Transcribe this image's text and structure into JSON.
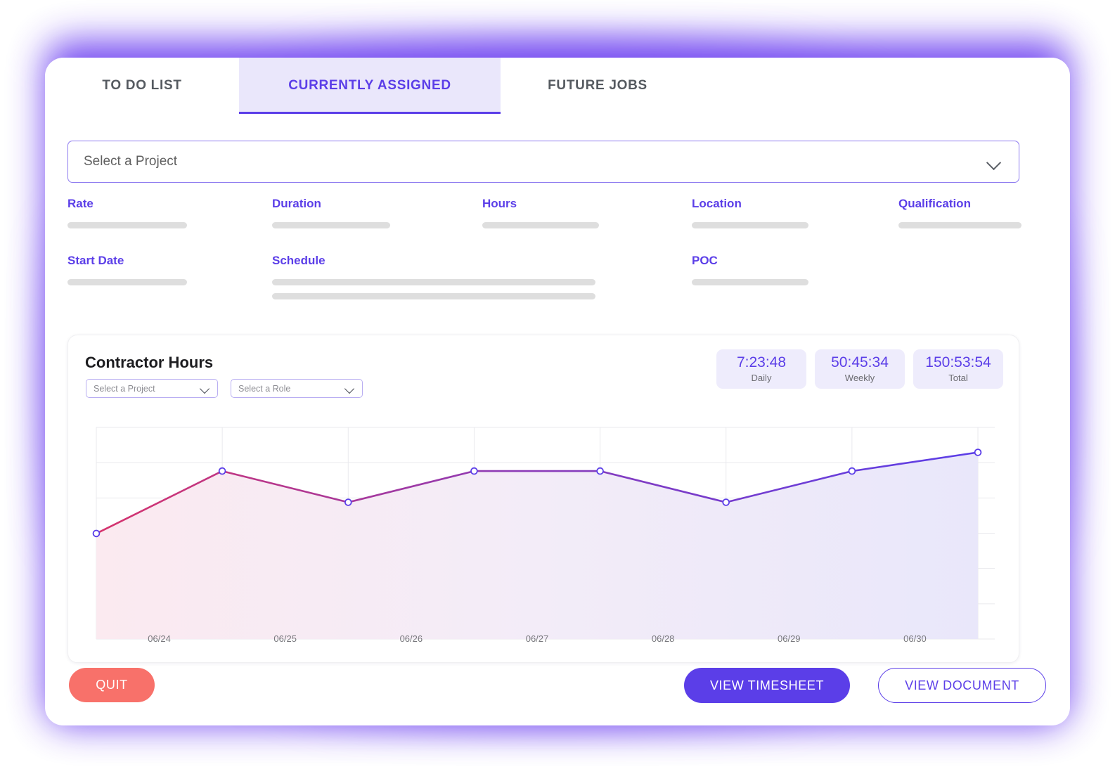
{
  "tabs": [
    {
      "id": "todo",
      "label": "TO DO LIST",
      "active": false
    },
    {
      "id": "current",
      "label": "CURRENTLY ASSIGNED",
      "active": true
    },
    {
      "id": "future",
      "label": "FUTURE JOBS",
      "active": false
    }
  ],
  "project_select": {
    "value": "Select a Project",
    "placeholder": "Select a Project",
    "icon": "chevron-down-icon"
  },
  "details": {
    "row1": [
      {
        "label": "Rate"
      },
      {
        "label": "Duration"
      },
      {
        "label": "Hours"
      },
      {
        "label": "Location"
      },
      {
        "label": "Qualification"
      }
    ],
    "row2": [
      {
        "label": "Start Date"
      },
      {
        "label": "Schedule"
      },
      {
        "label": "POC"
      }
    ]
  },
  "chart_card": {
    "title": "Contractor Hours",
    "filters": [
      {
        "id": "project",
        "value": "Select a Project",
        "placeholder": "Select a Project",
        "icon": "chevron-down-icon"
      },
      {
        "id": "role",
        "value": "Select a Role",
        "placeholder": "Select a Role",
        "icon": "chevron-down-icon"
      }
    ],
    "stats": [
      {
        "value": "7:23:48",
        "label": "Daily"
      },
      {
        "value": "50:45:34",
        "label": "Weekly"
      },
      {
        "value": "150:53:54",
        "label": "Total"
      }
    ]
  },
  "chart_data": {
    "type": "area",
    "title": "Contractor Hours",
    "xlabel": "",
    "ylabel": "",
    "categories": [
      "06/24",
      "06/25",
      "06/26",
      "06/27",
      "06/28",
      "06/29",
      "06/30"
    ],
    "x": [
      0,
      1,
      2,
      3,
      4,
      5,
      6
    ],
    "series": [
      {
        "name": "Contractor Hours",
        "values": [
          3.0,
          5.0,
          4.0,
          5.0,
          5.0,
          4.0,
          5.0,
          5.6
        ]
      }
    ],
    "values": [
      3.0,
      5.0,
      4.0,
      5.0,
      5.0,
      4.0,
      5.0,
      5.6
    ],
    "ylim": [
      0,
      6.4
    ],
    "grid": true,
    "legend": "none",
    "markers": "open-circle",
    "line_gradient": {
      "start": "#d6336c",
      "end": "#5b3ee8"
    },
    "fill_gradient": {
      "start": "#fbeef2",
      "end": "#eceafb"
    },
    "note": "Eight plotted vertices across seven day ticks; leftmost vertex sits on the y-axis before the 06/24 tick, rightmost vertex sits on the 06/30 tick."
  },
  "footer": {
    "quit_label": "QUIT",
    "view_timesheet_label": "VIEW TIMESHEET",
    "view_document_label": "VIEW DOCUMENT"
  },
  "colors": {
    "accent": "#5b3ee8",
    "accent_soft": "#eae7fb",
    "danger": "#f8716a",
    "placeholder_bar": "#dedede",
    "text_muted": "#6c6c72",
    "glow": "#6a3cf0"
  }
}
